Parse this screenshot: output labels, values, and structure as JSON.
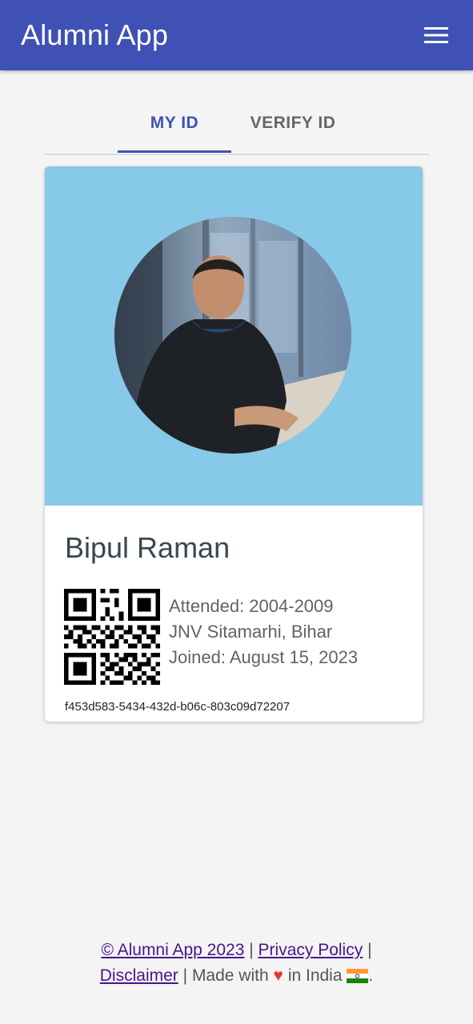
{
  "app_bar": {
    "title": "Alumni App",
    "menu_icon": "hamburger-menu-icon",
    "color": "#3f51b5"
  },
  "tabs": [
    {
      "label": "MY ID",
      "active": true
    },
    {
      "label": "VERIFY ID",
      "active": false
    }
  ],
  "card": {
    "header_color": "#87c9e8",
    "photo": "profile-photo",
    "name": "Bipul Raman",
    "details": [
      "Attended: 2004-2009",
      "JNV Sitamarhi, Bihar",
      "Joined: August 15, 2023"
    ],
    "qr_icon": "qr-code",
    "uuid": "f453d583-5434-432d-b06c-803c09d72207"
  },
  "footer": {
    "copyright_link": "© Alumni App 2023",
    "separator": "|",
    "privacy_link": "Privacy Policy",
    "disclaimer_link": "Disclaimer",
    "made_with": "Made with",
    "heart": "♥",
    "in_india": "in India",
    "flag_icon": "india-flag-icon",
    "period": "."
  }
}
